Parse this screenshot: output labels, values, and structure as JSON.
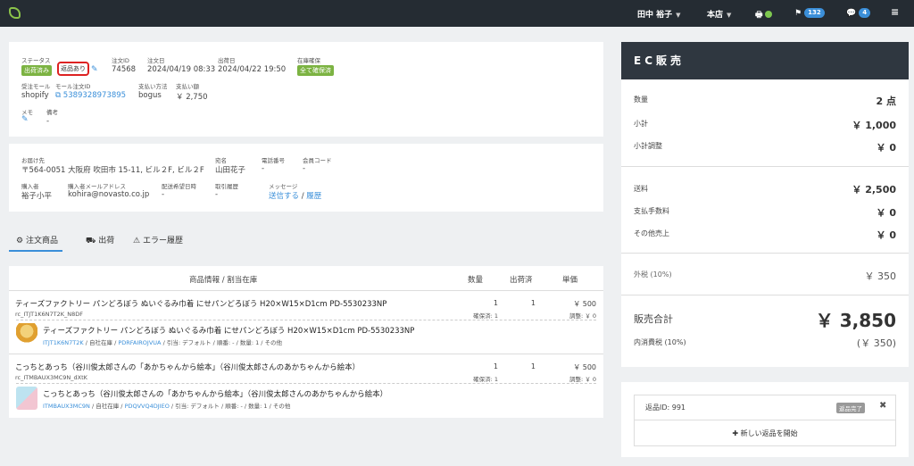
{
  "topbar": {
    "user": "田中 裕子",
    "store": "本店",
    "flag_count": "132",
    "chat_count": "4",
    "printer_icon": "printer-icon",
    "flag_icon": "flag-icon",
    "chat_icon": "chat-icon",
    "menu_icon": "hamburger-icon"
  },
  "order": {
    "status_label": "ステータス",
    "status_tag1": "出荷済み",
    "status_tag2": "返品あり",
    "order_id_label": "注文ID",
    "order_id": "74568",
    "order_date_label": "注文日",
    "order_date": "2024/04/19 08:33",
    "ship_date_label": "出荷日",
    "ship_date": "2024/04/22 19:50",
    "stock_label": "在庫確保",
    "stock_tag": "全て確保済",
    "mall_label": "受注モール",
    "mall": "shopify",
    "mall_order_label": "モール注文ID",
    "mall_order_id": "5389328973895",
    "pay_method_label": "支払い方法",
    "pay_method": "bogus",
    "pay_amount_label": "支払い額",
    "pay_amount": "￥ 2,750",
    "memo_label": "メモ",
    "note_label": "備考",
    "note": "-"
  },
  "delivery": {
    "dest_label": "お届け先",
    "dest": "〒564-0051 大阪府 吹田市 15-11, ビル２F, ビル２F",
    "addressee_label": "宛名",
    "addressee": "山田花子",
    "phone_label": "電話番号",
    "phone": "-",
    "member_label": "会員コード",
    "member": "-",
    "buyer_label": "購入者",
    "buyer": "裕子小平",
    "buyer_email_label": "購入者メールアドレス",
    "buyer_email": "kohira@novasto.co.jp",
    "wish_date_label": "配送希望日時",
    "wish_date": "-",
    "history_label": "取引履歴",
    "history": "-",
    "message_label": "メッセージ",
    "message_send": "送信する",
    "message_sep": " / ",
    "message_history": "履歴"
  },
  "tabs": [
    "注文商品",
    "出荷",
    "エラー履歴"
  ],
  "table": {
    "headers": [
      "商品情報 / 割当在庫",
      "数量",
      "出荷済",
      "単価"
    ],
    "rows": [
      {
        "name": "ティーズファクトリー パンどろぼう ぬいぐるみ巾着 にせパンどろぼう H20×W15×D1cm PD-5530233NP",
        "code": "rc_ITJT1K6N7T2K_N8DF",
        "qty": "1",
        "qty_sub": "確保済: 1",
        "shipped": "1",
        "price": "￥ 500",
        "price_sub": "調整: ￥ 0",
        "alloc_name": "ティーズファクトリー パンどろぼう ぬいぐるみ巾着 にせパンどろぼう H20×W15×D1cm PD-5530233NP",
        "alloc_code": "ITJT1K6N7T2K",
        "alloc_sep1": " / 自社在庫 / ",
        "alloc_sku": "PDRFAIROJVUA",
        "alloc_rest": " / 引当: デフォルト / 順番: - / 数量: 1 / その他"
      },
      {
        "name": "こっちとあっち（谷川俊太郎さんの「あかちゃんから絵本」（谷川俊太郎さんのあかちゃんから絵本）",
        "code": "rc_ITMBAUX3MC9N_dXtK",
        "qty": "1",
        "qty_sub": "確保済: 1",
        "shipped": "1",
        "price": "￥ 500",
        "price_sub": "調整: ￥ 0",
        "alloc_name": "こっちとあっち（谷川俊太郎さんの「あかちゃんから絵本」（谷川俊太郎さんのあかちゃんから絵本）",
        "alloc_code": "ITMBAUX3MC9N",
        "alloc_sep1": " / 自社在庫 / ",
        "alloc_sku": "PDQVVQ4DJIEO",
        "alloc_rest": " / 引当: デフォルト / 順番: - / 数量: 1 / その他"
      }
    ]
  },
  "ec": {
    "title": "EC販売",
    "qty_label": "数量",
    "qty": "2 点",
    "subtotal_label": "小計",
    "subtotal": "￥ 1,000",
    "subtotal_adj_label": "小計調整",
    "subtotal_adj": "￥ 0",
    "shipping_label": "送料",
    "shipping": "￥ 2,500",
    "fee_label": "支払手数料",
    "fee": "￥ 0",
    "other_label": "その他売上",
    "other": "￥ 0",
    "ext_tax_label": "外税 (10%)",
    "ext_tax": "￥ 350",
    "total_label": "販売合計",
    "total": "￥ 3,850",
    "incl_tax_label": "内消費税 (10%)",
    "incl_tax": "(￥ 350)"
  },
  "returns": {
    "return_id": "返品ID: 991",
    "return_status": "返品完了",
    "new_return": "新しい返品を開始"
  }
}
